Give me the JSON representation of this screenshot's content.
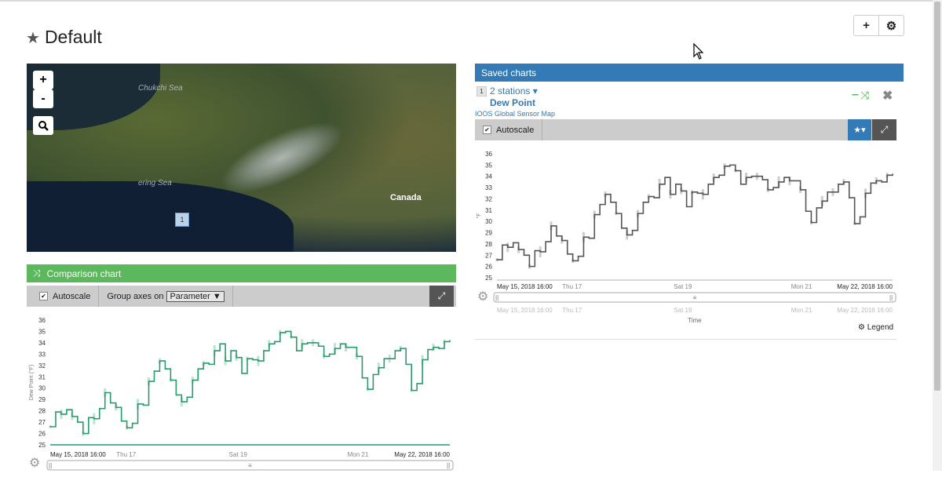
{
  "page": {
    "title": "Default"
  },
  "header_buttons": {
    "add": "+",
    "settings": "⚙"
  },
  "map": {
    "zoom_in": "+",
    "zoom_out": "-",
    "labels": {
      "canada": "Canada",
      "chukchi": "Chukchi Sea",
      "bering": "ering Sea"
    },
    "marker": "1"
  },
  "comparison": {
    "title": "Comparison chart",
    "autoscale_label": "Autoscale",
    "group_axes_label": "Group axes on",
    "group_axes_value": "Parameter ▼"
  },
  "saved": {
    "title": "Saved charts",
    "item_index": "1",
    "stations_label": "2 stations ▾",
    "parameter": "Dew Point",
    "source_link": "IOOS Global Sensor Map",
    "autoscale_label": "Autoscale",
    "legend_label": "Legend",
    "time_label": "Time"
  },
  "colors": {
    "green": "#5cb85c",
    "blue": "#337ab7",
    "series_green": "#2b9a6b",
    "series_gray": "#555555"
  },
  "chart_data": [
    {
      "type": "line",
      "title": "",
      "ylabel": "Dew Point (°F)",
      "ylim": [
        25,
        36
      ],
      "yticks": [
        25,
        26,
        27,
        28,
        29,
        30,
        31,
        32,
        33,
        34,
        35,
        36
      ],
      "xticks": [
        "May 15, 2018 16:00",
        "Thu 17",
        "Sat 19",
        "Mon 21",
        "May 22, 2018 16:00"
      ],
      "xtick_pos": [
        0,
        0.19,
        0.47,
        0.77,
        1.0
      ],
      "nav_xticks": [],
      "series": [
        {
          "color": "#2b9a6b",
          "values": [
            26.6,
            27.9,
            27.7,
            28.1,
            27.5,
            27.0,
            26.0,
            27.4,
            27.3,
            28.2,
            29.6,
            28.7,
            28.3,
            27.1,
            26.5,
            26.9,
            28.6,
            28.5,
            30.6,
            31.5,
            32.4,
            31.7,
            30.7,
            29.4,
            28.8,
            29.2,
            30.7,
            31.7,
            32.2,
            32.1,
            33.3,
            33.9,
            32.4,
            33.3,
            32.7,
            31.3,
            32.6,
            32.5,
            32.4,
            33.3,
            33.9,
            34.1,
            34.9,
            35.0,
            34.5,
            33.3,
            33.9,
            34.0,
            34.0,
            33.7,
            32.8,
            33.0,
            33.5,
            33.9,
            33.6,
            33.6,
            32.8,
            30.9,
            29.9,
            31.2,
            31.8,
            32.6,
            32.6,
            33.3,
            33.5,
            32.1,
            29.8,
            30.4,
            32.5,
            33.4,
            33.6,
            33.5,
            34.1,
            34.2
          ]
        }
      ]
    },
    {
      "type": "line",
      "title": "",
      "ylabel": "°F",
      "ylim": [
        25,
        36
      ],
      "yticks": [
        25,
        26,
        27,
        28,
        29,
        30,
        31,
        32,
        33,
        34,
        35,
        36
      ],
      "xticks": [
        "May 15, 2018 16:00",
        "Thu 17",
        "Sat 19",
        "Mon 21",
        "May 22, 2018 16:00"
      ],
      "xtick_pos": [
        0,
        0.19,
        0.47,
        0.77,
        1.0
      ],
      "nav_xticks": [
        "May 15, 2018 16:00",
        "Thu 17",
        "Sat 19",
        "Mon 21",
        "May 22, 2018 16:00"
      ],
      "xlabel": "Time",
      "series": [
        {
          "color": "#555555",
          "values": [
            26.6,
            27.9,
            27.7,
            28.1,
            27.5,
            27.0,
            26.0,
            27.4,
            27.3,
            28.2,
            29.6,
            28.7,
            28.3,
            27.1,
            26.5,
            26.9,
            28.6,
            28.5,
            30.6,
            31.5,
            32.4,
            31.7,
            30.7,
            29.4,
            28.8,
            29.2,
            30.7,
            31.7,
            32.2,
            32.1,
            33.3,
            33.9,
            32.4,
            33.3,
            32.7,
            31.3,
            32.6,
            32.5,
            32.4,
            33.3,
            33.9,
            34.1,
            34.9,
            35.0,
            34.5,
            33.3,
            33.9,
            34.0,
            34.0,
            33.7,
            32.8,
            33.0,
            33.5,
            33.9,
            33.6,
            33.6,
            32.8,
            30.9,
            29.9,
            31.2,
            31.8,
            32.6,
            32.6,
            33.3,
            33.5,
            32.1,
            29.8,
            30.4,
            32.5,
            33.4,
            33.6,
            33.5,
            34.1,
            34.2
          ]
        }
      ]
    }
  ]
}
